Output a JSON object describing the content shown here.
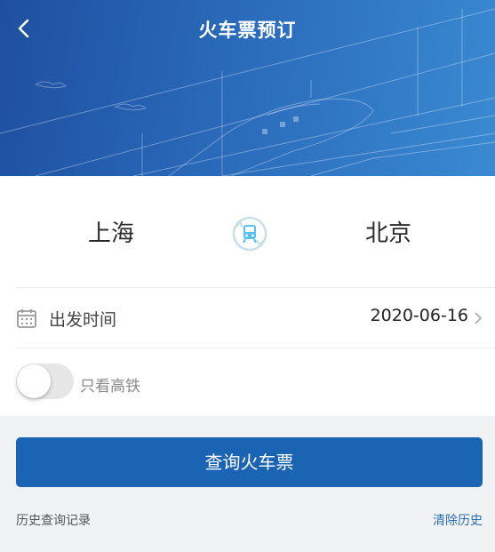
{
  "header": {
    "title": "火车票预订",
    "back_icon": "chevron-left-icon"
  },
  "route": {
    "from_city": "上海",
    "to_city": "北京",
    "swap_icon": "train-swap-icon"
  },
  "date": {
    "label": "出发时间",
    "value": "2020-06-16",
    "icon": "calendar-icon"
  },
  "filter": {
    "high_speed_only_label": "只看高铁",
    "high_speed_only_on": false
  },
  "actions": {
    "search_label": "查询火车票"
  },
  "history": {
    "label": "历史查询记录",
    "clear_label": "清除历史"
  },
  "colors": {
    "banner": "#2a69b9",
    "primary_button": "#1b63b3",
    "link": "#2a6db5"
  }
}
